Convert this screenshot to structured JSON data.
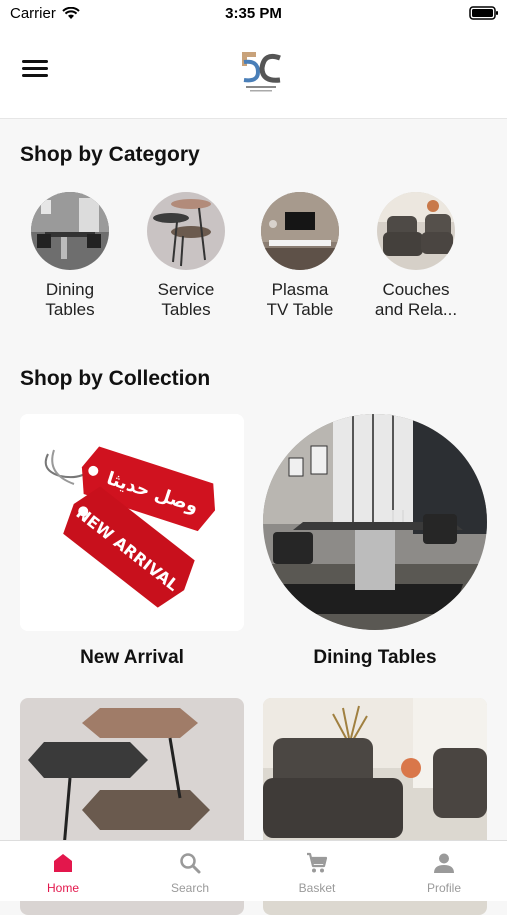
{
  "status_bar": {
    "carrier": "Carrier",
    "time": "3:35 PM"
  },
  "header": {
    "logo_alt": "logo"
  },
  "categories": {
    "title": "Shop by Category",
    "items": [
      {
        "label": "Dining\nTables"
      },
      {
        "label": "Service\nTables"
      },
      {
        "label": "Plasma\nTV Table"
      },
      {
        "label": "Couches\nand Rela..."
      }
    ]
  },
  "collections": {
    "title": "Shop by Collection",
    "items": [
      {
        "label": "New Arrival",
        "tag_text_ar": "وصل حديثا",
        "tag_text_en": "NEW ARRIVAL"
      },
      {
        "label": "Dining Tables"
      },
      {
        "label": ""
      },
      {
        "label": ""
      }
    ]
  },
  "tabbar": {
    "items": [
      {
        "label": "Home",
        "icon": "home-icon",
        "active": true
      },
      {
        "label": "Search",
        "icon": "search-icon",
        "active": false
      },
      {
        "label": "Basket",
        "icon": "cart-icon",
        "active": false
      },
      {
        "label": "Profile",
        "icon": "profile-icon",
        "active": false
      }
    ]
  },
  "colors": {
    "accent": "#e3174c",
    "tag_red": "#d0121f"
  }
}
